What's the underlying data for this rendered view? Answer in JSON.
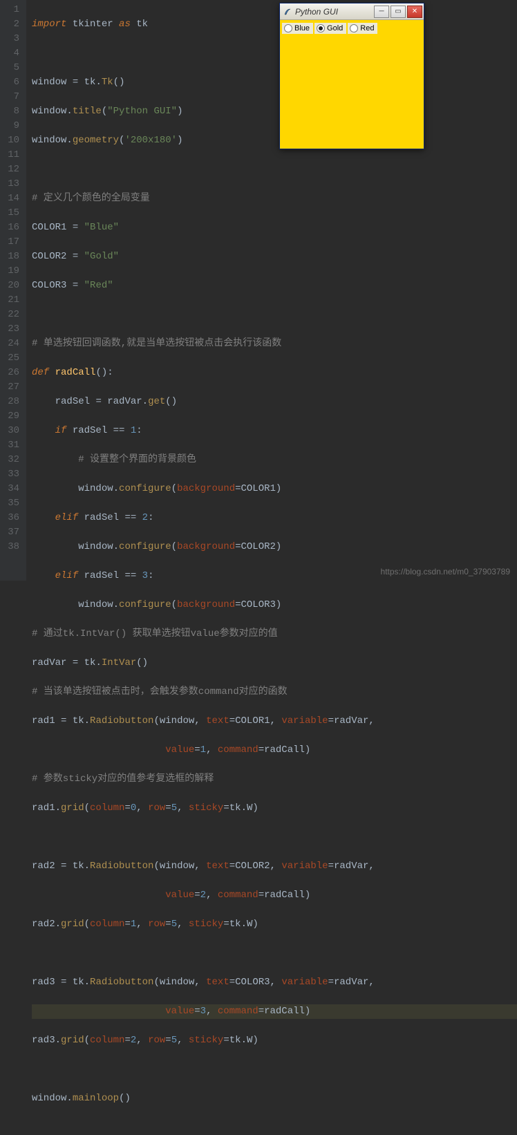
{
  "editor": {
    "line_count": 38,
    "highlighted_line": 35,
    "lines": {
      "l1": {
        "kw1": "import",
        "mod": "tkinter",
        "kw2": "as",
        "alias": "tk"
      },
      "l3": {
        "v": "window",
        "op": "=",
        "obj": "tk",
        "fn": "Tk",
        "args": "()"
      },
      "l4": {
        "obj": "window",
        "fn": "title",
        "str": "\"Python GUI\""
      },
      "l5": {
        "obj": "window",
        "fn": "geometry",
        "str": "'200x180'"
      },
      "l7": {
        "cmt": "# 定义几个颜色的全局变量"
      },
      "l8": {
        "v": "COLOR1",
        "op": "=",
        "str": "\"Blue\""
      },
      "l9": {
        "v": "COLOR2",
        "op": "=",
        "str": "\"Gold\""
      },
      "l10": {
        "v": "COLOR3",
        "op": "=",
        "str": "\"Red\""
      },
      "l12": {
        "cmt": "# 单选按钮回调函数,就是当单选按钮被点击会执行该函数"
      },
      "l13": {
        "kw": "def",
        "fn": "radCall",
        "args": "():"
      },
      "l14": {
        "v": "radSel",
        "op": "=",
        "obj": "radVar",
        "fn": "get",
        "args": "()"
      },
      "l15": {
        "kw": "if",
        "v": "radSel",
        "op": "==",
        "num": "1",
        "colon": ":"
      },
      "l16": {
        "cmt": "# 设置整个界面的背景颜色"
      },
      "l17": {
        "obj": "window",
        "fn": "configure",
        "p": "background",
        "eq": "=",
        "val": "COLOR1"
      },
      "l18": {
        "kw": "elif",
        "v": "radSel",
        "op": "==",
        "num": "2",
        "colon": ":"
      },
      "l19": {
        "obj": "window",
        "fn": "configure",
        "p": "background",
        "eq": "=",
        "val": "COLOR2"
      },
      "l20": {
        "kw": "elif",
        "v": "radSel",
        "op": "==",
        "num": "3",
        "colon": ":"
      },
      "l21": {
        "obj": "window",
        "fn": "configure",
        "p": "background",
        "eq": "=",
        "val": "COLOR3"
      },
      "l22": {
        "cmt": "# 通过tk.IntVar() 获取单选按钮value参数对应的值"
      },
      "l23": {
        "v": "radVar",
        "op": "=",
        "obj": "tk",
        "fn": "IntVar",
        "args": "()"
      },
      "l24": {
        "cmt": "# 当该单选按钮被点击时，会触发参数command对应的函数"
      },
      "l25": {
        "v": "rad1",
        "op": "=",
        "obj": "tk",
        "fn": "Radiobutton",
        "arg1": "window",
        "p1": "text",
        "pv1": "COLOR1",
        "p2": "variable",
        "pv2": "radVar",
        "comma": ","
      },
      "l26": {
        "p1": "value",
        "pv1": "1",
        "p2": "command",
        "pv2": "radCall"
      },
      "l27": {
        "cmt": "# 参数sticky对应的值参考复选框的解释"
      },
      "l28": {
        "obj": "rad1",
        "fn": "grid",
        "p1": "column",
        "pv1": "0",
        "p2": "row",
        "pv2": "5",
        "p3": "sticky",
        "pv3a": "tk",
        "pv3b": "W"
      },
      "l30": {
        "v": "rad2",
        "op": "=",
        "obj": "tk",
        "fn": "Radiobutton",
        "arg1": "window",
        "p1": "text",
        "pv1": "COLOR2",
        "p2": "variable",
        "pv2": "radVar",
        "comma": ","
      },
      "l31": {
        "p1": "value",
        "pv1": "2",
        "p2": "command",
        "pv2": "radCall"
      },
      "l32": {
        "obj": "rad2",
        "fn": "grid",
        "p1": "column",
        "pv1": "1",
        "p2": "row",
        "pv2": "5",
        "p3": "sticky",
        "pv3a": "tk",
        "pv3b": "W"
      },
      "l34": {
        "v": "rad3",
        "op": "=",
        "obj": "tk",
        "fn": "Radiobutton",
        "arg1": "window",
        "p1": "text",
        "pv1": "COLOR3",
        "p2": "variable",
        "pv2": "radVar",
        "comma": ","
      },
      "l35": {
        "p1": "value",
        "pv1": "3",
        "p2": "command",
        "pv2": "radCall"
      },
      "l36": {
        "obj": "rad3",
        "fn": "grid",
        "p1": "column",
        "pv1": "2",
        "p2": "row",
        "pv2": "5",
        "p3": "sticky",
        "pv3a": "tk",
        "pv3b": "W"
      },
      "l38": {
        "obj": "window",
        "fn": "mainloop",
        "args": "()"
      }
    }
  },
  "tkwindow": {
    "title": "Python GUI",
    "radios": [
      {
        "label": "Blue",
        "selected": false
      },
      {
        "label": "Gold",
        "selected": true
      },
      {
        "label": "Red",
        "selected": false
      }
    ],
    "bg_color": "#ffd700"
  },
  "watermark": "https://blog.csdn.net/m0_37903789"
}
